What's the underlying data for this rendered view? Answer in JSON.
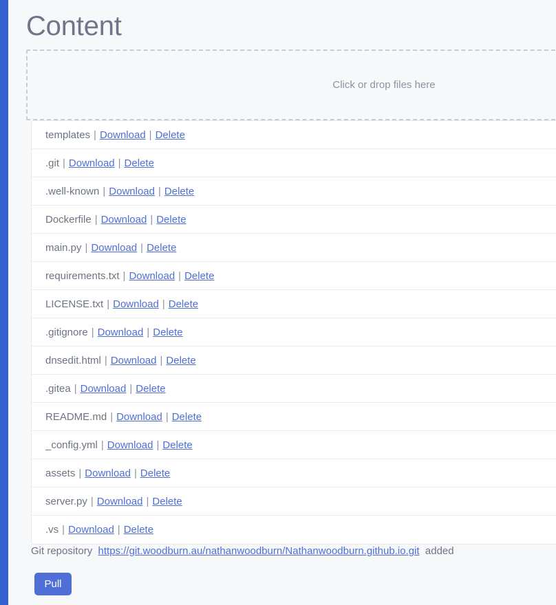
{
  "theme": {
    "sidebar_color": "#3560d0",
    "background_color": "#f7f8fa",
    "link_color": "#4f6fd6",
    "text_color": "#6c7483",
    "accent_button_color": "#4f6fd6",
    "dropzone_border_color": "#c9ccd4"
  },
  "page": {
    "title": "Content"
  },
  "dropzone": {
    "label": "Click or drop files here"
  },
  "file_list": {
    "separator": "|",
    "download_label": "Download",
    "delete_label": "Delete",
    "items": [
      {
        "name": "templates"
      },
      {
        "name": ".git"
      },
      {
        "name": ".well-known"
      },
      {
        "name": "Dockerfile"
      },
      {
        "name": "main.py"
      },
      {
        "name": "requirements.txt"
      },
      {
        "name": "LICENSE.txt"
      },
      {
        "name": ".gitignore"
      },
      {
        "name": "dnsedit.html"
      },
      {
        "name": ".gitea"
      },
      {
        "name": "README.md"
      },
      {
        "name": "_config.yml"
      },
      {
        "name": "assets"
      },
      {
        "name": "server.py"
      },
      {
        "name": ".vs"
      }
    ]
  },
  "status": {
    "prefix": "Git repository",
    "repo_url": "https://git.woodburn.au/nathanwoodburn/Nathanwoodburn.github.io.git",
    "suffix": "added"
  },
  "actions": {
    "pull_label": "Pull"
  }
}
